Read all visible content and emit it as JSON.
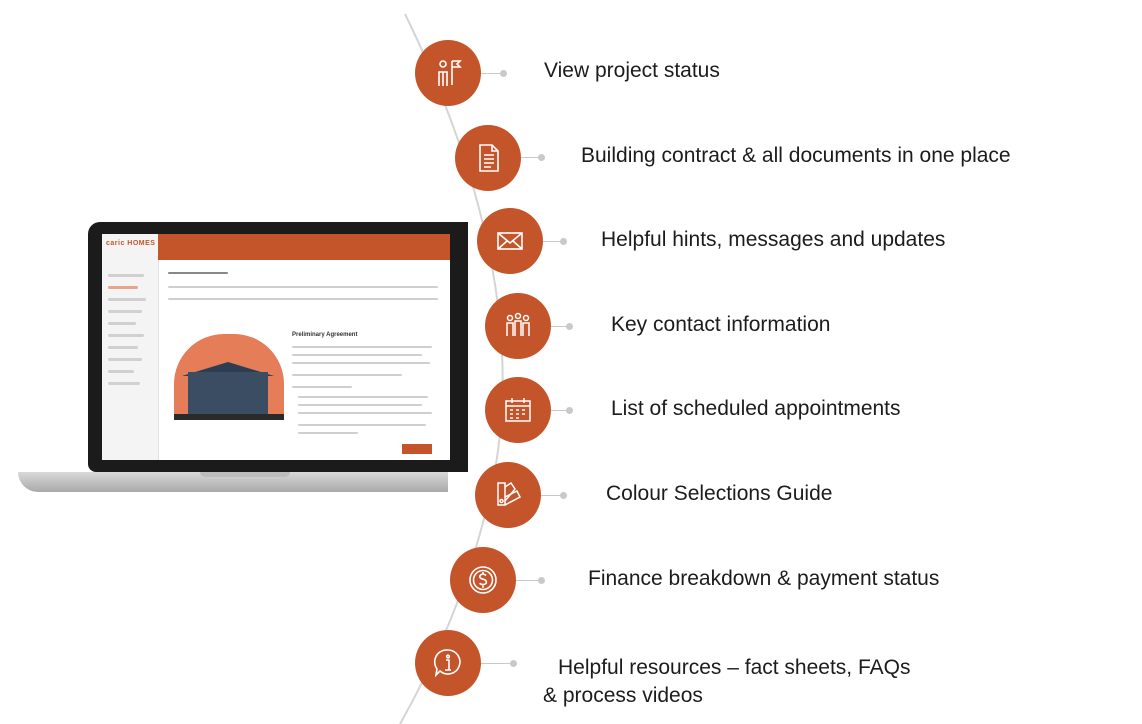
{
  "colors": {
    "accent": "#c4552a",
    "connector": "#c9c9c9",
    "arc": "#d5d5d5"
  },
  "laptop": {
    "brand": "caric HOMES",
    "heading": "Preliminary Agreement"
  },
  "features": [
    {
      "icon": "project-flag-person-icon",
      "label": "View project status"
    },
    {
      "icon": "document-icon",
      "label": "Building contract & all documents in one place"
    },
    {
      "icon": "envelope-icon",
      "label": "Helpful hints, messages and updates"
    },
    {
      "icon": "people-group-icon",
      "label": "Key contact information"
    },
    {
      "icon": "calendar-icon",
      "label": "List of scheduled appointments"
    },
    {
      "icon": "colour-swatch-icon",
      "label": "Colour Selections Guide"
    },
    {
      "icon": "dollar-coin-icon",
      "label": "Finance breakdown & payment status"
    },
    {
      "icon": "info-speech-bubble-icon",
      "label": "Helpful resources – fact sheets, FAQs",
      "label_line2": "& process videos"
    }
  ]
}
